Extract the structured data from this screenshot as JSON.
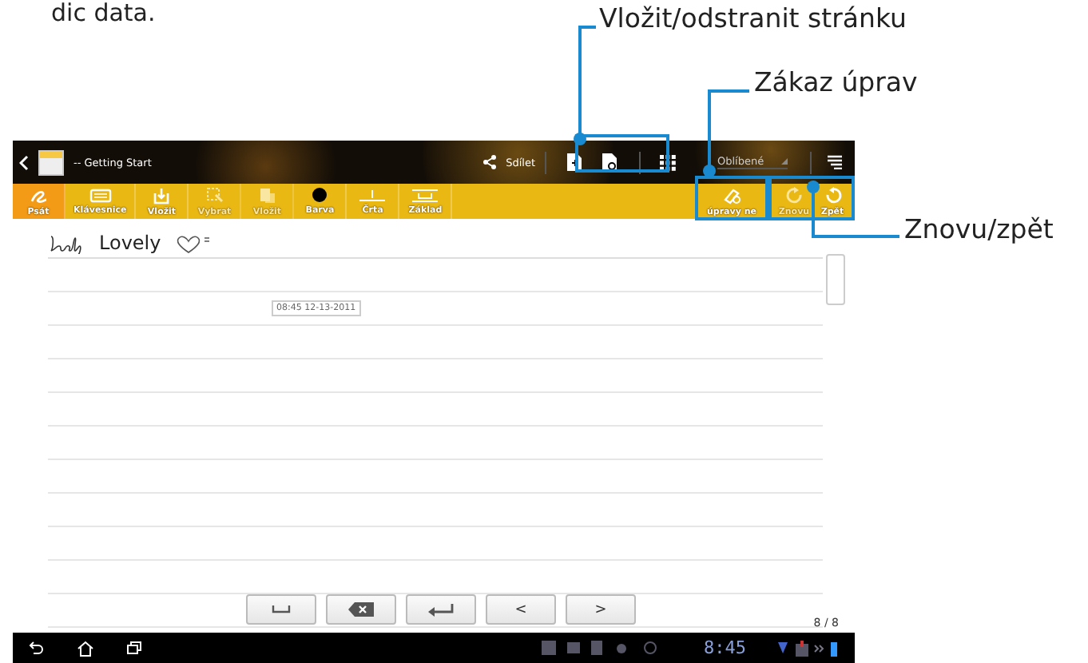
{
  "caption_fragment": "dic data.",
  "title_bar": {
    "title": "-- Getting Start",
    "share": "Sdílet",
    "notebook": "Oblíbené"
  },
  "toolbar": {
    "left": [
      {
        "label": "Psát",
        "kind": "pen",
        "selected": true,
        "disabled": false
      },
      {
        "label": "Klávesnice",
        "kind": "keyboard",
        "selected": false,
        "disabled": false
      },
      {
        "label": "Vložit",
        "kind": "insert",
        "selected": false,
        "disabled": false
      },
      {
        "label": "Vybrat",
        "kind": "select",
        "selected": false,
        "disabled": true
      },
      {
        "label": "Vložit",
        "kind": "paste",
        "selected": false,
        "disabled": true
      },
      {
        "label": "Barva",
        "kind": "color",
        "selected": false,
        "disabled": false
      },
      {
        "label": "Črta",
        "kind": "stroke",
        "selected": false,
        "disabled": false
      },
      {
        "label": "Základ",
        "kind": "base",
        "selected": false,
        "disabled": false
      }
    ],
    "right": [
      {
        "label": "úpravy ne",
        "kind": "readonly",
        "selected": false,
        "disabled": false
      },
      {
        "label": "Znovu",
        "kind": "redo",
        "selected": false,
        "disabled": true
      },
      {
        "label": "Zpět",
        "kind": "undo",
        "selected": false,
        "disabled": false
      }
    ]
  },
  "note": {
    "typed_text": "Lovely",
    "timestamp": "08:45 12-13-2011",
    "page_counter": "8 / 8"
  },
  "keys": [
    {
      "kind": "space"
    },
    {
      "kind": "backspace"
    },
    {
      "kind": "enter"
    },
    {
      "kind": "left",
      "label": "<"
    },
    {
      "kind": "right",
      "label": ">"
    }
  ],
  "status_bar": {
    "time": "8:45"
  },
  "callouts": [
    {
      "label": "Vložit/odstranit stránku",
      "kind": "pages"
    },
    {
      "label": "Zákaz úprav",
      "kind": "readonly"
    },
    {
      "label": "Znovu/zpět",
      "kind": "undo"
    }
  ]
}
